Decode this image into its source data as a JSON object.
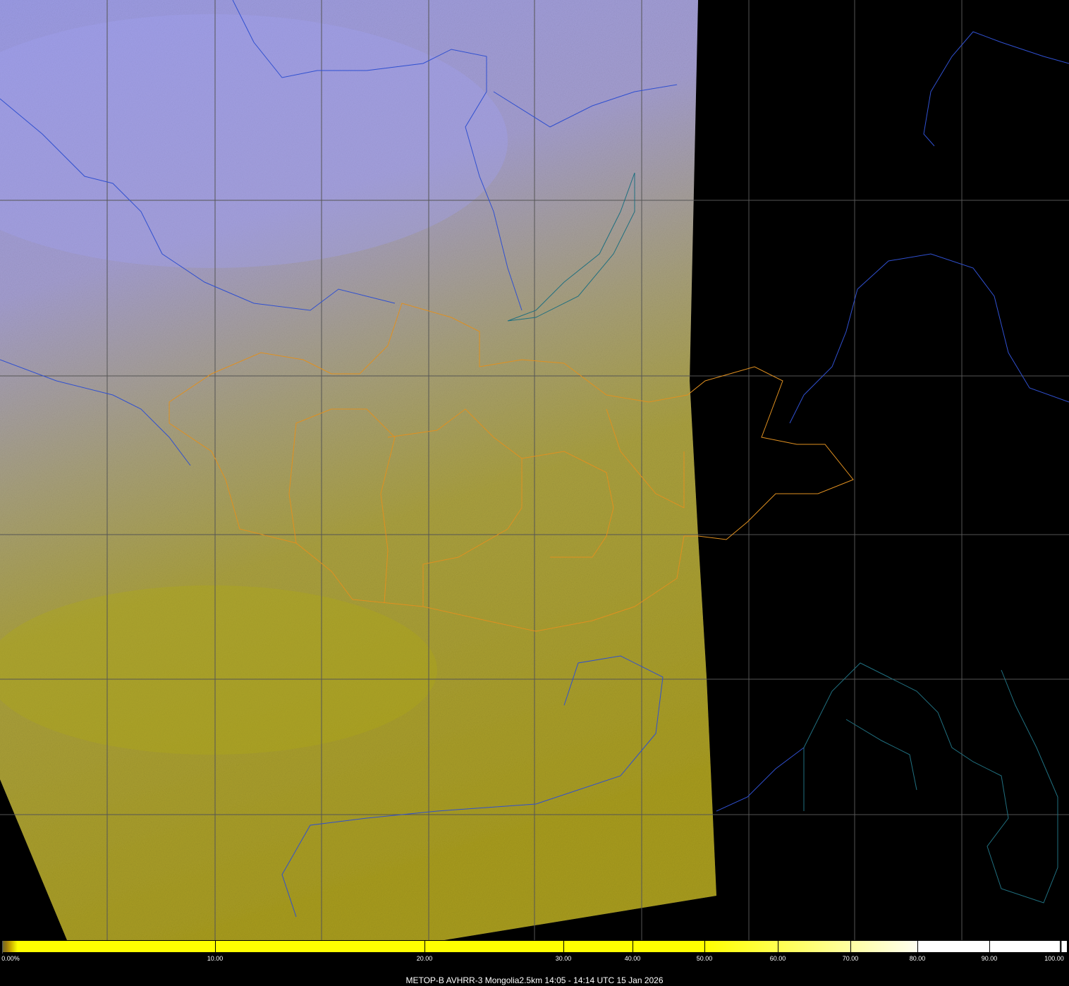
{
  "map": {
    "satellite_swath_colors": {
      "cloud": "#9a9ae8",
      "ground": "#a8a030",
      "background": "#000000"
    },
    "border_colors": {
      "country": "#3050d0",
      "province": "#e09020",
      "coast": "#207080",
      "lakes": "#208080"
    }
  },
  "colorbar": {
    "unit": "%",
    "ticks": [
      "0.00%",
      "10.00",
      "20.00",
      "30.00",
      "40.00",
      "50.00",
      "60.00",
      "70.00",
      "80.00",
      "90.00",
      "100.00"
    ]
  },
  "caption": "METOP-B AVHRR-3 Mongolia2.5km 14:05 - 14:14 UTC 15 Jan 2026"
}
